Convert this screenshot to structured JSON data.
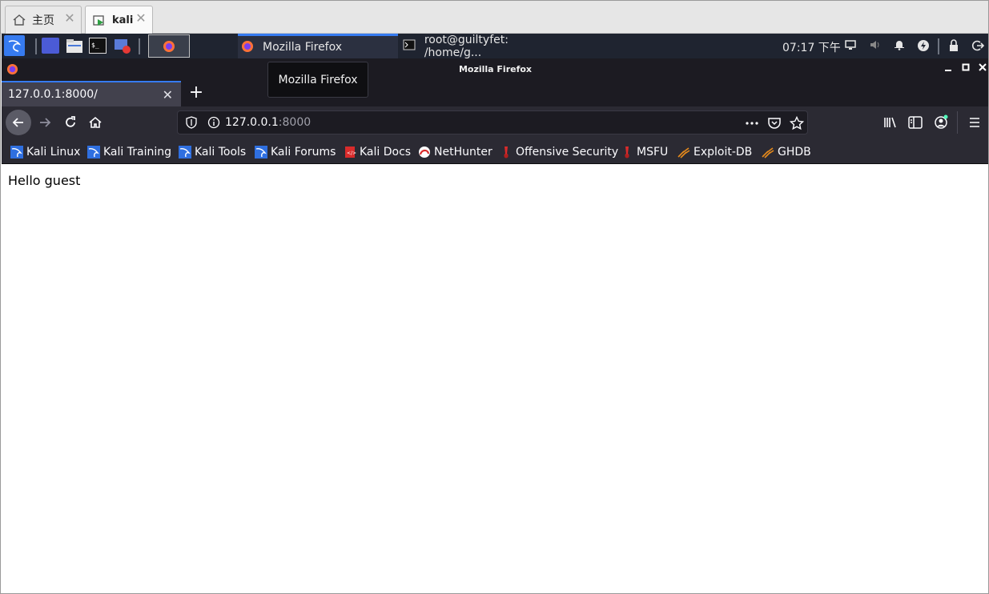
{
  "host_tabs": [
    {
      "label": "主页"
    },
    {
      "label": "kali"
    }
  ],
  "panel": {
    "tasks": [
      {
        "label": "Mozilla Firefox"
      },
      {
        "label": "root@guiltyfet: /home/g..."
      }
    ],
    "clock": "07:17 下午"
  },
  "window": {
    "title": "Mozilla Firefox",
    "tooltip": "Mozilla Firefox"
  },
  "tab": {
    "label": "127.0.0.1:8000/"
  },
  "urlbar": {
    "host": "127.0.0.1",
    "port": ":8000"
  },
  "bookmarks": [
    {
      "label": "Kali Linux",
      "icon": "kali-dragon-icon"
    },
    {
      "label": "Kali Training",
      "icon": "kali-dragon-icon"
    },
    {
      "label": "Kali Tools",
      "icon": "kali-dragon-icon"
    },
    {
      "label": "Kali Forums",
      "icon": "kali-dragon-icon"
    },
    {
      "label": "Kali Docs",
      "icon": "kali-docs-icon"
    },
    {
      "label": "NetHunter",
      "icon": "nethunter-icon"
    },
    {
      "label": "Offensive Security",
      "icon": "offsec-icon"
    },
    {
      "label": "MSFU",
      "icon": "offsec-icon"
    },
    {
      "label": "Exploit-DB",
      "icon": "exploitdb-icon"
    },
    {
      "label": "GHDB",
      "icon": "exploitdb-icon"
    }
  ],
  "page": {
    "body_text": "Hello guest"
  },
  "colors": {
    "accent": "#367bf0",
    "toolbar": "#2b2a33",
    "titlebar": "#1c1b22",
    "panel": "#1f2430"
  }
}
